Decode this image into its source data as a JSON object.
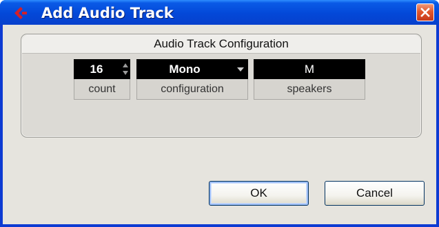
{
  "window": {
    "title": "Add Audio Track"
  },
  "panel": {
    "title": "Audio Track Configuration",
    "count": {
      "value": "16",
      "label": "count"
    },
    "configuration": {
      "value": "Mono",
      "label": "configuration"
    },
    "speakers": {
      "value": "M",
      "label": "speakers"
    }
  },
  "buttons": {
    "ok": "OK",
    "cancel": "Cancel"
  },
  "colors": {
    "titlebar": "#0348d8",
    "close": "#e2572c",
    "logo": "#d3202a",
    "panel": "#dcdad5"
  },
  "icons": {
    "app": "cubase-logo-icon",
    "close": "close-icon",
    "spinner": "spinner-arrows-icon",
    "dropdown": "chevron-down-icon"
  }
}
